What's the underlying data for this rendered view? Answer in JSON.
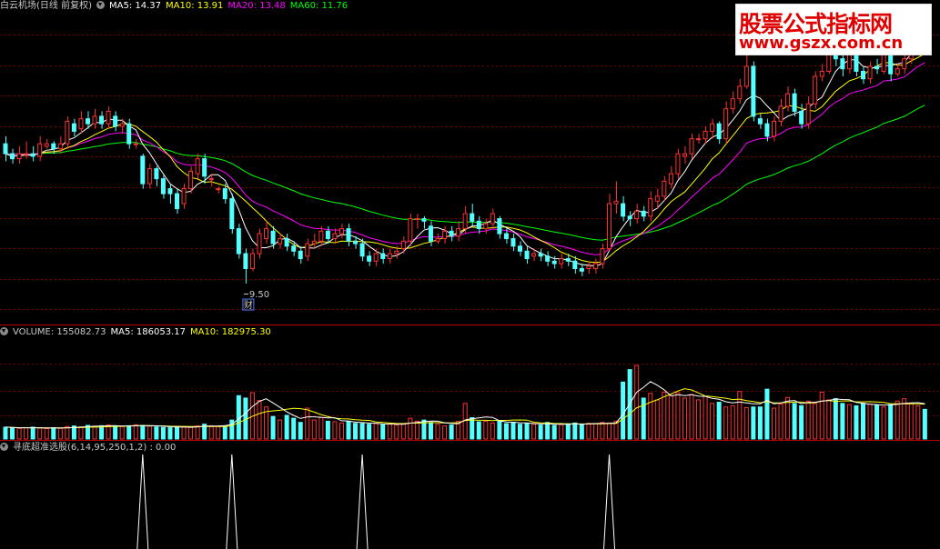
{
  "price_header": {
    "title": "白云机场(日线 前复权)",
    "ma5": "MA5: 14.37",
    "ma10": "MA10: 13.91",
    "ma20": "MA20: 13.48",
    "ma60": "MA60: 11.76"
  },
  "volume_header": {
    "volume": "VOLUME: 155082.73",
    "ma5": "MA5: 186053.17",
    "ma10": "MA10: 182975.30"
  },
  "indicator_header": {
    "label": "寻底超准选股(6,14,95,250,1,2) : 0.00"
  },
  "watermark": {
    "line1": "股票公式指标网",
    "line2": "www.gszx.com.cn"
  },
  "annotations": {
    "low_price": "9.50",
    "fin_marker": "财"
  },
  "colors": {
    "up": "#ff3232",
    "down": "#54ffff",
    "ma5": "#ffffff",
    "ma10": "#ffff00",
    "ma20": "#ff00ff",
    "ma60": "#00ff00",
    "grid": "#7a0000",
    "separator": "#b00000",
    "signal": "#ffffff"
  },
  "chart_data": [
    {
      "type": "candlestick",
      "name": "price",
      "y_range": [
        8.9,
        15.05
      ],
      "candles": [
        [
          12.5,
          12.3,
          12.65,
          12.15
        ],
        [
          12.3,
          12.2,
          12.4,
          12.1
        ],
        [
          12.2,
          12.3,
          12.45,
          12.1
        ],
        [
          12.3,
          12.3,
          12.55,
          12.2
        ],
        [
          12.3,
          12.25,
          12.45,
          12.15
        ],
        [
          12.25,
          12.5,
          12.65,
          12.15
        ],
        [
          12.45,
          12.5,
          12.6,
          12.4
        ],
        [
          12.5,
          12.4,
          12.55,
          12.3
        ],
        [
          12.4,
          12.5,
          12.65,
          12.3
        ],
        [
          12.5,
          12.95,
          13.05,
          12.4
        ],
        [
          12.9,
          12.75,
          13.0,
          12.65
        ],
        [
          12.8,
          13.0,
          13.15,
          12.7
        ],
        [
          13.0,
          12.9,
          13.15,
          12.8
        ],
        [
          12.9,
          13.05,
          13.2,
          12.8
        ],
        [
          13.05,
          12.9,
          13.15,
          12.8
        ],
        [
          12.9,
          13.15,
          13.25,
          12.8
        ],
        [
          13.05,
          12.85,
          13.15,
          12.75
        ],
        [
          12.85,
          12.9,
          13.0,
          12.7
        ],
        [
          12.9,
          12.5,
          13.0,
          12.4
        ],
        [
          12.5,
          12.5,
          12.6,
          12.4
        ],
        [
          12.25,
          11.7,
          12.3,
          11.6
        ],
        [
          11.7,
          12.0,
          12.1,
          11.6
        ],
        [
          12.0,
          11.8,
          12.05,
          11.65
        ],
        [
          11.8,
          11.5,
          11.9,
          11.4
        ],
        [
          11.6,
          11.5,
          11.7,
          11.3
        ],
        [
          11.5,
          11.2,
          11.6,
          11.1
        ],
        [
          11.3,
          11.6,
          11.7,
          11.2
        ],
        [
          11.6,
          11.95,
          12.05,
          11.5
        ],
        [
          11.9,
          12.2,
          12.3,
          11.8
        ],
        [
          12.2,
          11.85,
          12.3,
          11.7
        ],
        [
          11.8,
          11.8,
          11.9,
          11.65
        ],
        [
          11.6,
          11.6,
          11.65,
          11.5
        ],
        [
          11.6,
          11.4,
          11.7,
          11.3
        ],
        [
          11.4,
          10.8,
          11.5,
          10.7
        ],
        [
          10.8,
          10.3,
          10.9,
          10.2
        ],
        [
          10.3,
          10.0,
          10.4,
          9.7
        ],
        [
          10.0,
          10.3,
          10.4,
          9.95
        ],
        [
          10.3,
          10.7,
          10.8,
          10.2
        ],
        [
          10.6,
          10.8,
          10.95,
          10.5
        ],
        [
          10.75,
          10.5,
          10.85,
          10.4
        ],
        [
          10.5,
          10.6,
          10.7,
          10.4
        ],
        [
          10.6,
          10.45,
          10.7,
          10.35
        ],
        [
          10.45,
          10.35,
          10.55,
          10.25
        ],
        [
          10.35,
          10.2,
          10.45,
          10.1
        ],
        [
          10.25,
          10.5,
          10.6,
          10.15
        ],
        [
          10.5,
          10.55,
          10.7,
          10.4
        ],
        [
          10.55,
          10.75,
          10.85,
          10.45
        ],
        [
          10.75,
          10.6,
          10.85,
          10.5
        ],
        [
          10.6,
          10.7,
          10.8,
          10.5
        ],
        [
          10.7,
          10.8,
          10.9,
          10.6
        ],
        [
          10.8,
          10.55,
          10.9,
          10.45
        ],
        [
          10.55,
          10.5,
          10.65,
          10.4
        ],
        [
          10.5,
          10.25,
          10.6,
          10.15
        ],
        [
          10.25,
          10.15,
          10.35,
          10.05
        ],
        [
          10.15,
          10.3,
          10.4,
          10.05
        ],
        [
          10.3,
          10.2,
          10.4,
          10.1
        ],
        [
          10.2,
          10.3,
          10.4,
          10.1
        ],
        [
          10.3,
          10.35,
          10.45,
          10.2
        ],
        [
          10.4,
          10.55,
          10.65,
          10.3
        ],
        [
          10.55,
          11.0,
          11.1,
          10.45
        ],
        [
          11.0,
          11.0,
          11.1,
          10.8
        ],
        [
          11.0,
          10.95,
          11.05,
          10.8
        ],
        [
          10.85,
          10.55,
          10.95,
          10.45
        ],
        [
          10.55,
          10.6,
          10.7,
          10.5
        ],
        [
          10.6,
          10.75,
          10.85,
          10.5
        ],
        [
          10.75,
          10.65,
          10.85,
          10.55
        ],
        [
          10.65,
          10.8,
          10.95,
          10.55
        ],
        [
          10.8,
          11.1,
          11.25,
          10.7
        ],
        [
          11.1,
          10.95,
          11.3,
          10.85
        ],
        [
          10.95,
          10.8,
          11.05,
          10.7
        ],
        [
          10.8,
          10.9,
          11.0,
          10.7
        ],
        [
          10.9,
          11.1,
          11.2,
          10.8
        ],
        [
          11.0,
          10.7,
          11.05,
          10.6
        ],
        [
          10.7,
          10.6,
          10.8,
          10.5
        ],
        [
          10.6,
          10.45,
          10.7,
          10.35
        ],
        [
          10.45,
          10.35,
          10.55,
          10.25
        ],
        [
          10.35,
          10.2,
          10.45,
          10.1
        ],
        [
          10.25,
          10.3,
          10.4,
          10.15
        ],
        [
          10.3,
          10.25,
          10.4,
          10.15
        ],
        [
          10.25,
          10.15,
          10.35,
          10.05
        ],
        [
          10.15,
          10.1,
          10.25,
          10.0
        ],
        [
          10.1,
          10.2,
          10.3,
          10.0
        ],
        [
          10.2,
          10.15,
          10.3,
          10.05
        ],
        [
          10.15,
          10.0,
          10.25,
          9.9
        ],
        [
          10.0,
          9.95,
          10.1,
          9.85
        ],
        [
          10.0,
          10.05,
          10.15,
          9.9
        ],
        [
          10.0,
          10.1,
          10.2,
          9.9
        ],
        [
          10.1,
          10.4,
          10.5,
          10.0
        ],
        [
          10.4,
          11.3,
          11.5,
          10.35
        ],
        [
          11.3,
          11.35,
          11.75,
          11.1
        ],
        [
          11.3,
          11.05,
          11.45,
          10.95
        ],
        [
          11.05,
          11.0,
          11.15,
          10.85
        ],
        [
          11.0,
          11.15,
          11.3,
          10.9
        ],
        [
          11.15,
          11.05,
          11.25,
          10.95
        ],
        [
          11.05,
          11.4,
          11.55,
          10.95
        ],
        [
          11.35,
          11.45,
          11.6,
          11.2
        ],
        [
          11.45,
          11.75,
          11.85,
          11.35
        ],
        [
          11.7,
          11.9,
          12.05,
          11.6
        ],
        [
          11.9,
          12.3,
          12.4,
          11.8
        ],
        [
          12.25,
          12.3,
          12.45,
          12.1
        ],
        [
          12.3,
          12.6,
          12.7,
          12.2
        ],
        [
          12.6,
          12.6,
          12.7,
          12.5
        ],
        [
          12.6,
          12.75,
          12.85,
          12.5
        ],
        [
          12.75,
          12.9,
          13.0,
          12.6
        ],
        [
          12.9,
          12.6,
          12.95,
          12.5
        ],
        [
          12.6,
          13.2,
          13.35,
          12.5
        ],
        [
          13.2,
          13.4,
          13.55,
          13.1
        ],
        [
          13.4,
          13.65,
          13.8,
          13.3
        ],
        [
          13.65,
          14.05,
          14.3,
          13.6
        ],
        [
          14.05,
          13.05,
          14.15,
          12.95
        ],
        [
          13.0,
          12.9,
          13.1,
          12.8
        ],
        [
          12.9,
          12.65,
          13.0,
          12.55
        ],
        [
          12.65,
          12.95,
          13.05,
          12.55
        ],
        [
          12.95,
          13.25,
          13.4,
          12.85
        ],
        [
          13.25,
          13.5,
          13.65,
          13.15
        ],
        [
          13.5,
          13.15,
          13.6,
          13.05
        ],
        [
          13.15,
          12.9,
          13.3,
          12.8
        ],
        [
          12.9,
          13.3,
          13.45,
          12.8
        ],
        [
          13.3,
          13.85,
          13.95,
          13.2
        ],
        [
          13.85,
          13.95,
          14.1,
          13.75
        ],
        [
          13.95,
          14.45,
          14.95,
          13.9
        ],
        [
          14.45,
          14.2,
          14.55,
          14.05
        ],
        [
          14.2,
          14.0,
          14.3,
          13.85
        ],
        [
          14.0,
          14.3,
          14.4,
          13.9
        ],
        [
          14.3,
          13.95,
          14.4,
          13.85
        ],
        [
          13.95,
          13.8,
          14.05,
          13.7
        ],
        [
          13.8,
          14.05,
          14.15,
          13.7
        ],
        [
          14.05,
          14.0,
          14.2,
          13.9
        ],
        [
          13.95,
          14.55,
          14.65,
          13.9
        ],
        [
          14.55,
          13.9,
          14.6,
          13.75
        ],
        [
          13.9,
          14.0,
          14.1,
          13.85
        ],
        [
          14.0,
          14.2,
          14.35,
          13.9
        ],
        [
          14.2,
          14.85,
          14.95,
          14.1
        ],
        [
          14.85,
          14.95,
          15.05,
          14.75
        ],
        [
          14.95,
          14.75,
          15.05,
          14.65
        ]
      ],
      "low_marker": {
        "index": 35,
        "value": 9.5
      }
    },
    {
      "type": "bar",
      "name": "volume",
      "y_range": [
        0,
        850000
      ],
      "values": [
        100000,
        95000,
        90000,
        95000,
        100000,
        92000,
        88000,
        95000,
        90000,
        105000,
        110000,
        102000,
        115000,
        108000,
        112000,
        118000,
        110000,
        105000,
        112000,
        120000,
        115000,
        108000,
        102000,
        98000,
        95000,
        105000,
        102000,
        98000,
        110000,
        125000,
        112000,
        105000,
        110000,
        160000,
        365000,
        345000,
        390000,
        325000,
        270000,
        190000,
        160000,
        200000,
        175000,
        140000,
        260000,
        160000,
        180000,
        150000,
        145000,
        135000,
        150000,
        132000,
        130000,
        125000,
        130000,
        120000,
        128000,
        118000,
        130000,
        175000,
        150000,
        160000,
        140000,
        125000,
        110000,
        118000,
        150000,
        300000,
        180000,
        145000,
        150000,
        135000,
        155000,
        130000,
        140000,
        125000,
        130000,
        125000,
        118000,
        140000,
        115000,
        122000,
        128000,
        135000,
        125000,
        132000,
        130000,
        140000,
        135000,
        150000,
        480000,
        585000,
        620000,
        345000,
        385000,
        330000,
        395000,
        365000,
        390000,
        345000,
        375000,
        330000,
        360000,
        300000,
        310000,
        270000,
        280000,
        400000,
        265000,
        270000,
        270000,
        420000,
        260000,
        295000,
        350000,
        300000,
        280000,
        320000,
        300000,
        395000,
        330000,
        340000,
        300000,
        290000,
        280000,
        300000,
        295000,
        285000,
        270000,
        290000,
        320000,
        340000,
        300000,
        280000,
        250000
      ]
    },
    {
      "type": "line",
      "name": "寻底超准选股",
      "y_range": [
        0,
        1
      ],
      "signal_indices": [
        20,
        33,
        52,
        88
      ],
      "current_value": 0.0
    }
  ]
}
